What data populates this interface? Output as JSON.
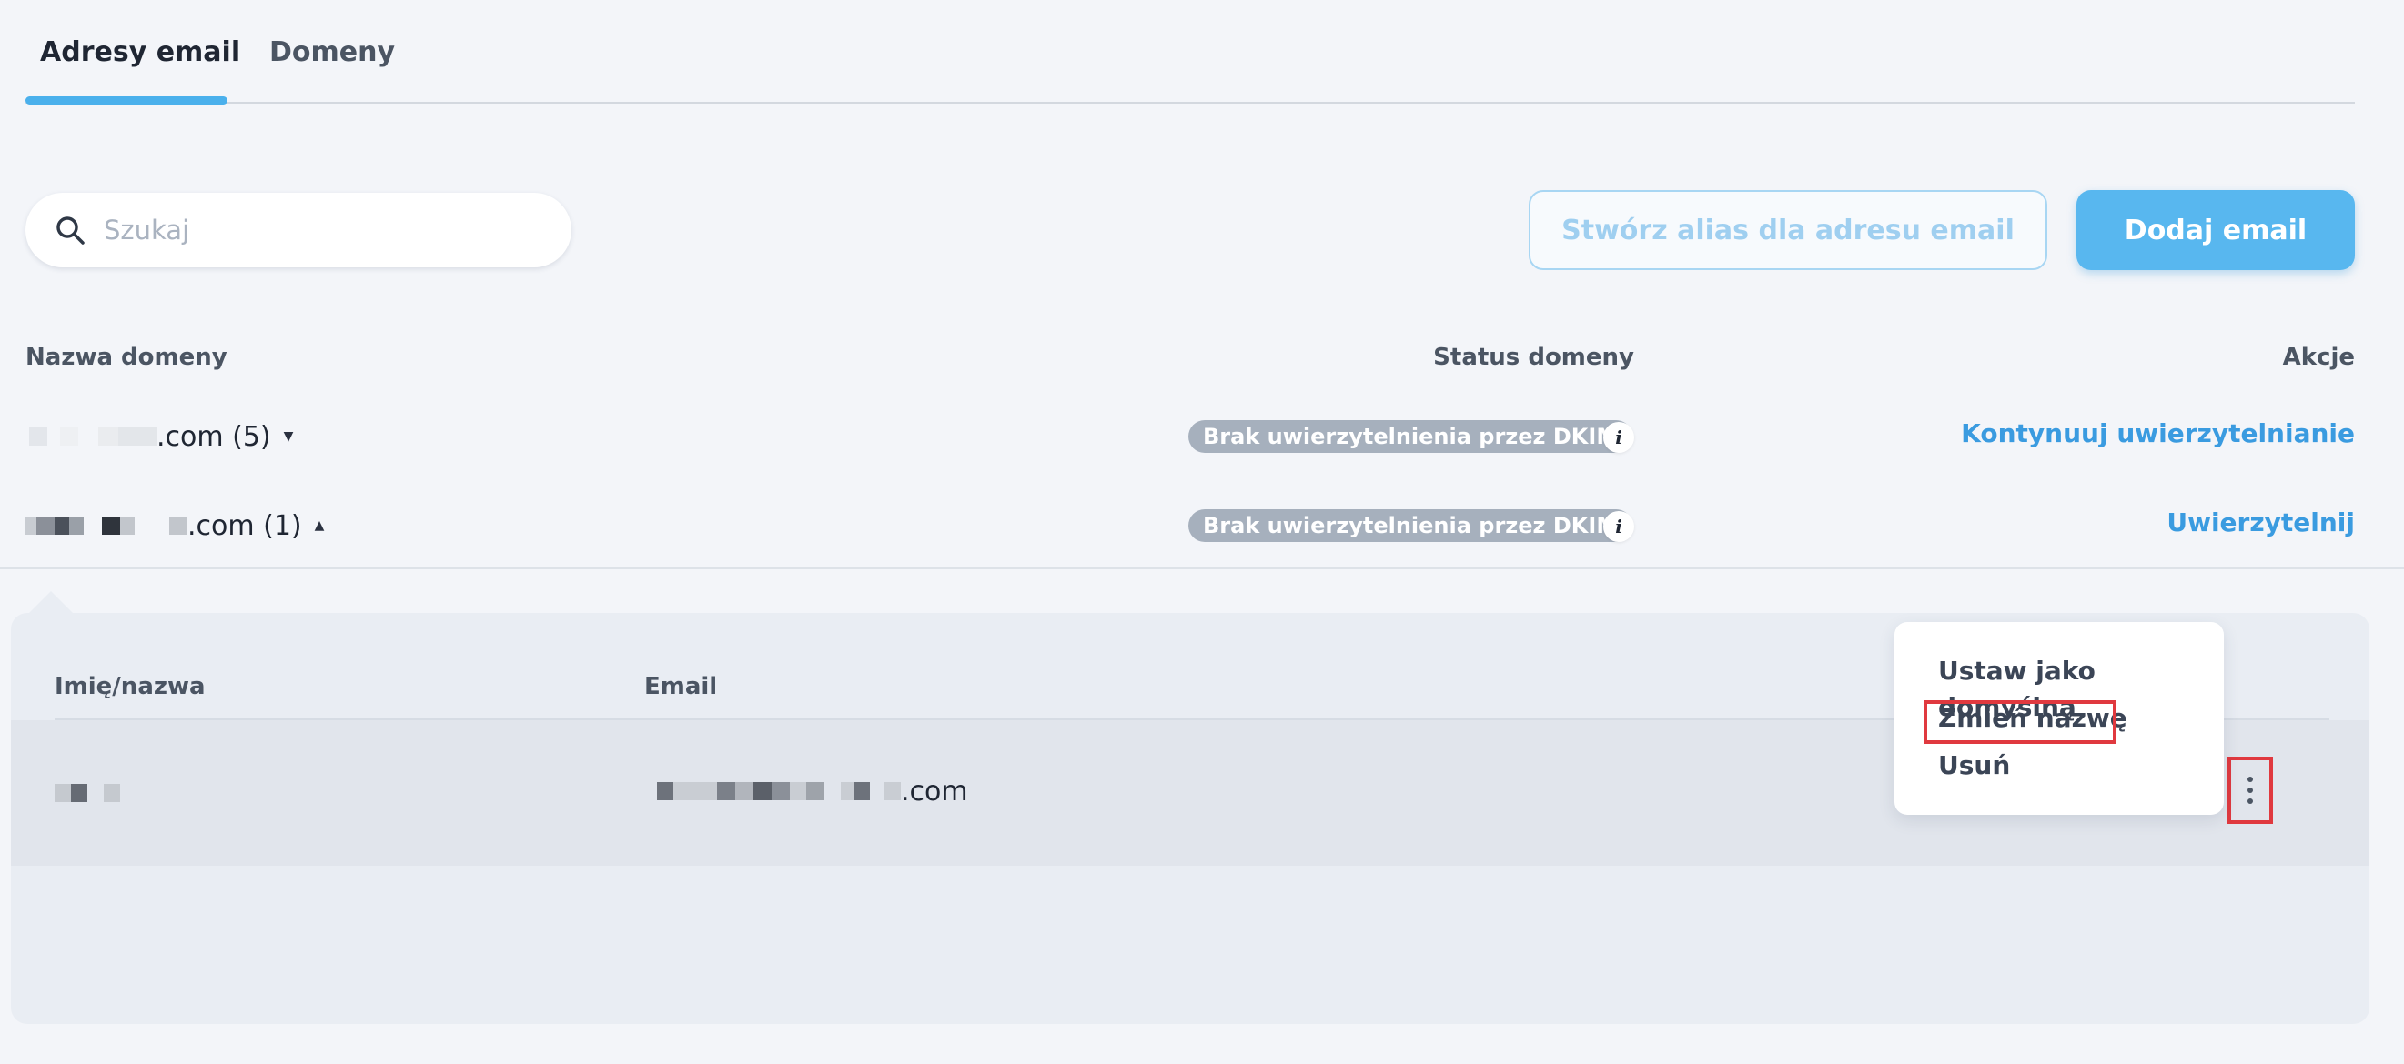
{
  "tabs": [
    {
      "label": "Adresy email",
      "active": true
    },
    {
      "label": "Domeny",
      "active": false
    }
  ],
  "search": {
    "placeholder": "Szukaj"
  },
  "buttons": {
    "create_alias": "Stwórz alias dla adresu email",
    "add_email": "Dodaj email"
  },
  "domain_table": {
    "headers": {
      "name": "Nazwa domeny",
      "status": "Status domeny",
      "actions": "Akcje"
    },
    "rows": [
      {
        "name_suffix": ".com (5)",
        "status": "Brak uwierzytelnienia przez DKIM",
        "action": "Kontynuuj uwierzytelnianie",
        "expanded": false
      },
      {
        "name_suffix": ".com (1)",
        "status": "Brak uwierzytelnienia przez DKIM",
        "action": "Uwierzytelnij",
        "expanded": true
      }
    ]
  },
  "email_table": {
    "headers": {
      "name": "Imię/nazwa",
      "email": "Email"
    },
    "rows": [
      {
        "email_suffix": ".com"
      }
    ]
  },
  "context_menu": {
    "items": [
      "Ustaw jako domyślną",
      "Zmień nazwę",
      "Usuń"
    ],
    "highlighted": "Zmień nazwę"
  },
  "colors": {
    "accent": "#4ab0ec",
    "primary_button": "#58b7ef",
    "link": "#3a9be0",
    "badge": "#a6b0bd",
    "highlight": "#e0393f"
  },
  "icons": {
    "search": "search-icon",
    "info": "info-icon",
    "caret_down": "caret-down-icon",
    "caret_up": "caret-up-icon",
    "more": "more-vertical-icon"
  }
}
